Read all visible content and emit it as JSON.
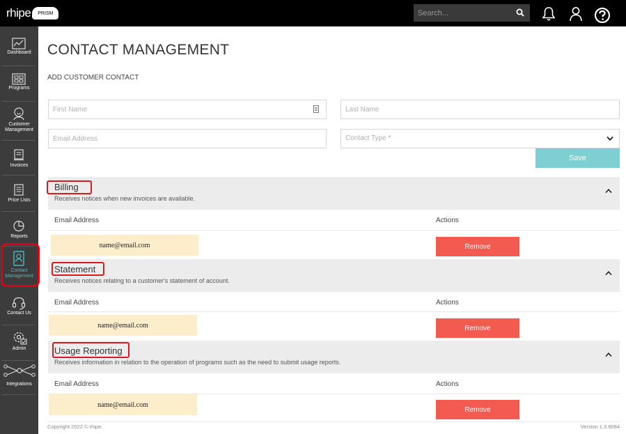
{
  "brand": {
    "name": "rhipe",
    "badge": "PRISM"
  },
  "search": {
    "placeholder": "Search..."
  },
  "sidebar": {
    "items": [
      {
        "label": "Dashboard"
      },
      {
        "label": "Programs"
      },
      {
        "label": "Customer\nManagement"
      },
      {
        "label": "Invoices"
      },
      {
        "label": "Price Lists"
      },
      {
        "label": "Reports"
      },
      {
        "label": "Contact\nManagement",
        "active": true
      },
      {
        "label": "Contact Us"
      },
      {
        "label": "Admin"
      },
      {
        "label": "Integrations"
      }
    ]
  },
  "page": {
    "title": "CONTACT MANAGEMENT",
    "subtitle": "ADD CUSTOMER CONTACT"
  },
  "form": {
    "first_name_placeholder": "First Name",
    "last_name_placeholder": "Last Name",
    "email_placeholder": "Email Address",
    "contact_type_placeholder": "Contact Type *",
    "save_label": "Save"
  },
  "sections": [
    {
      "title": "Billing",
      "description": "Receives notices when new invoices are available.",
      "col_email": "Email Address",
      "col_actions": "Actions",
      "email": "name@email.com",
      "remove_label": "Remove"
    },
    {
      "title": "Statement",
      "description": "Receives notices relating to a customer's statement of account.",
      "col_email": "Email Address",
      "col_actions": "Actions",
      "email": "name@email.com",
      "remove_label": "Remove"
    },
    {
      "title": "Usage Reporting",
      "description": "Receives information in relation to the operation of programs such as the need to submit usage reports.",
      "col_email": "Email Address",
      "col_actions": "Actions",
      "email": "name@email.com",
      "remove_label": "Remove"
    }
  ],
  "footer": {
    "copyright": "Copyright 2022 © rhipe.",
    "version": "Version 1.3.6084"
  },
  "colors": {
    "topbar": "#000000",
    "sidebar": "#3c3c3c",
    "accent": "#7ecfd1",
    "remove": "#f35b51",
    "highlight": "#fdeecb",
    "annotation": "#d8191e"
  },
  "icons": [
    "search-icon",
    "bell-icon",
    "user-icon",
    "help-icon",
    "chevron-down-icon",
    "chevron-up-icon",
    "contact-card-icon"
  ]
}
